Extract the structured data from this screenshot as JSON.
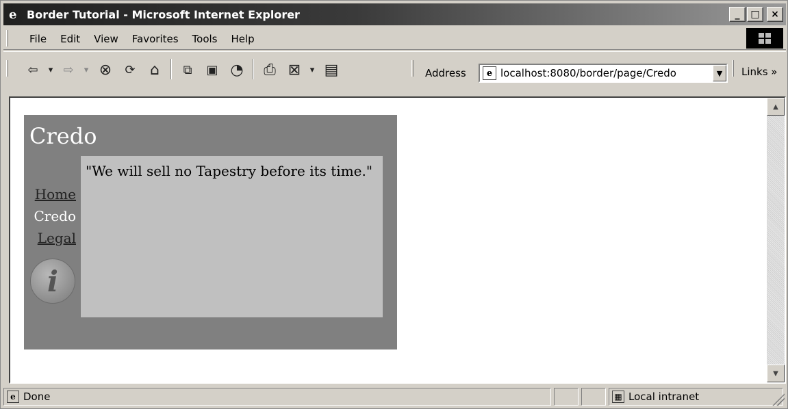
{
  "window": {
    "title": "Border Tutorial - Microsoft Internet Explorer",
    "min": "_",
    "max": "□",
    "close": "×"
  },
  "menu": [
    "File",
    "Edit",
    "View",
    "Favorites",
    "Tools",
    "Help"
  ],
  "toolbar": {
    "back": "⇦",
    "back_dd": "▾",
    "forward": "⇨",
    "forward_dd": "▾",
    "stop": "⊗",
    "refresh": "⟳",
    "home": "⌂",
    "search": "⧉",
    "favorites": "▣",
    "history": "◔",
    "print": "⎙",
    "edit": "⊠",
    "edit_dd": "▾",
    "discuss": "▤"
  },
  "address": {
    "label": "Address",
    "url": "localhost:8080/border/page/Credo",
    "dropdown": "▼"
  },
  "links_label": "Links »",
  "page": {
    "title": "Credo",
    "nav": [
      "Home",
      "Credo",
      "Legal"
    ],
    "credo": "\"We will sell no Tapestry before its time.\"",
    "info_glyph": "i"
  },
  "status": {
    "text": "Done",
    "zone": "Local intranet"
  },
  "colors": {
    "border_bg": "#808080",
    "content_bg": "#c0c0c0",
    "window_bg": "#d4d0c8"
  }
}
